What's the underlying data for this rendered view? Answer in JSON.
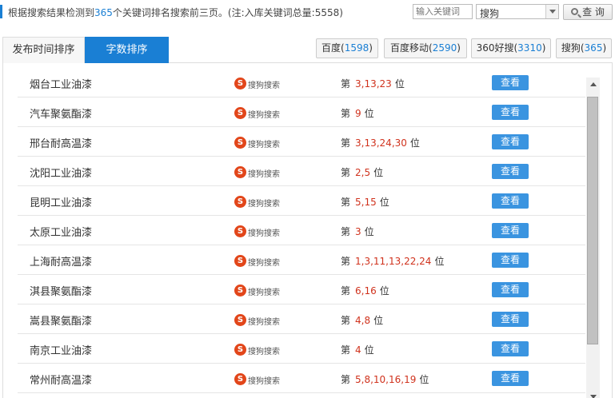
{
  "summary": {
    "prefix": "根据搜索结果检测到",
    "count": "365",
    "suffix": "个关键词排名搜索前三页。(注:入库关键词总量:5558)"
  },
  "search": {
    "placeholder": "输入关键词",
    "engine_value": "搜狗",
    "query_label": "查 询"
  },
  "tabs": [
    {
      "label": "发布时间排序"
    },
    {
      "label": "字数排序"
    }
  ],
  "engines": [
    {
      "name": "百度",
      "count": "1598"
    },
    {
      "name": "百度移动",
      "count": "2590"
    },
    {
      "name": "360好搜",
      "count": "3310"
    },
    {
      "name": "搜狗",
      "count": "365"
    }
  ],
  "logo": {
    "glyph": "S",
    "text": "搜狗搜索"
  },
  "rank_prefix": "第",
  "rank_suffix": "位",
  "view_label": "查看",
  "rows": [
    {
      "keyword": "烟台工业油漆",
      "positions": "3,13,23"
    },
    {
      "keyword": "汽车聚氨酯漆",
      "positions": "9"
    },
    {
      "keyword": "邢台耐高温漆",
      "positions": "3,13,24,30"
    },
    {
      "keyword": "沈阳工业油漆",
      "positions": "2,5"
    },
    {
      "keyword": "昆明工业油漆",
      "positions": "5,15"
    },
    {
      "keyword": "太原工业油漆",
      "positions": "3"
    },
    {
      "keyword": "上海耐高温漆",
      "positions": "1,3,11,13,22,24"
    },
    {
      "keyword": "淇县聚氨酯漆",
      "positions": "6,16"
    },
    {
      "keyword": "嵩县聚氨酯漆",
      "positions": "4,8"
    },
    {
      "keyword": "南京工业油漆",
      "positions": "4"
    },
    {
      "keyword": "常州耐高温漆",
      "positions": "5,8,10,16,19"
    }
  ],
  "colors": {
    "accent": "#1a7fd4",
    "rank": "#d0321d",
    "button": "#3a94e0",
    "logo": "#e2461a"
  }
}
